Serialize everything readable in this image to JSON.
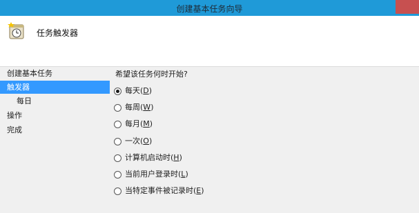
{
  "window": {
    "title": "创建基本任务向导"
  },
  "header": {
    "heading": "任务触发器",
    "icon": "task-scheduler-clock-icon"
  },
  "sidebar": {
    "items": [
      {
        "label": "创建基本任务",
        "selected": false
      },
      {
        "label": "触发器",
        "selected": true
      },
      {
        "label": "每日",
        "selected": false
      },
      {
        "label": "操作",
        "selected": false
      },
      {
        "label": "完成",
        "selected": false
      }
    ]
  },
  "main": {
    "question": "希望该任务何时开始?",
    "options": [
      {
        "text": "每天(",
        "key": "D",
        "end": ")",
        "checked": true
      },
      {
        "text": "每周(",
        "key": "W",
        "end": ")",
        "checked": false
      },
      {
        "text": "每月(",
        "key": "M",
        "end": ")",
        "checked": false
      },
      {
        "text": "一次(",
        "key": "O",
        "end": ")",
        "checked": false
      },
      {
        "text": "计算机启动时(",
        "key": "H",
        "end": ")",
        "checked": false
      },
      {
        "text": "当前用户登录时(",
        "key": "L",
        "end": ")",
        "checked": false
      },
      {
        "text": "当特定事件被记录时(",
        "key": "E",
        "end": ")",
        "checked": false
      }
    ]
  },
  "colors": {
    "titlebar": "#1f9ad8",
    "selection": "#3399ff",
    "close": "#c75050"
  }
}
